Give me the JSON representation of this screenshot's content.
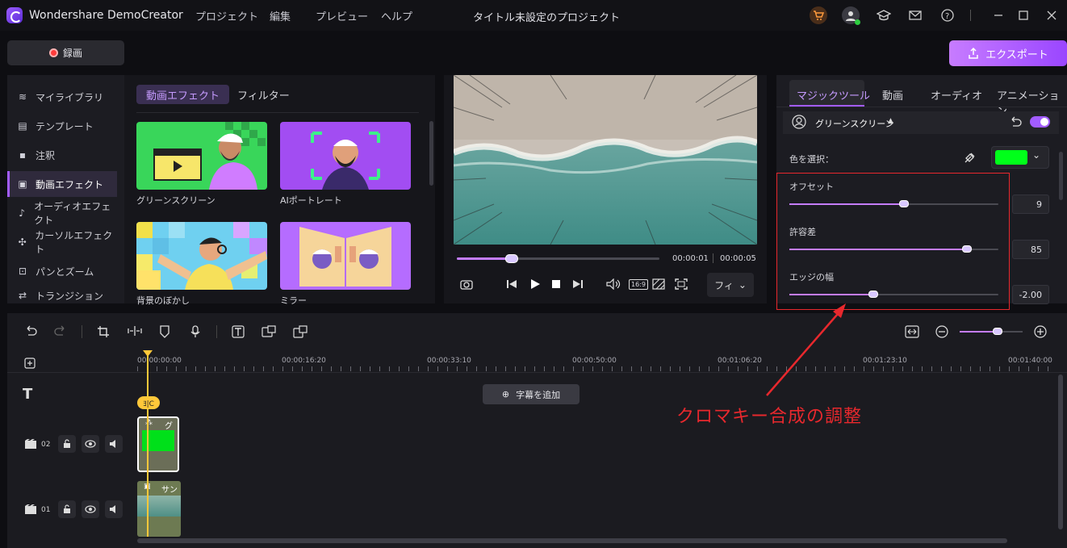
{
  "app": {
    "title": "Wondershare DemoCreator",
    "menu": [
      "プロジェクト",
      "編集",
      "プレビュー",
      "ヘルプ"
    ],
    "project_title": "タイトル未設定のプロジェクト"
  },
  "toolbar": {
    "record_label": "録画",
    "export_label": "エクスポート"
  },
  "sidebar": {
    "items": [
      {
        "label": "マイライブラリ",
        "icon": "layers-icon"
      },
      {
        "label": "テンプレート",
        "icon": "template-icon"
      },
      {
        "label": "注釈",
        "icon": "annotation-icon"
      },
      {
        "label": "動画エフェクト",
        "icon": "video-effect-icon"
      },
      {
        "label": "オーディオエフェクト",
        "icon": "audio-effect-icon"
      },
      {
        "label": "カーソルエフェクト",
        "icon": "cursor-effect-icon"
      },
      {
        "label": "パンとズーム",
        "icon": "pan-zoom-icon"
      },
      {
        "label": "トランジション",
        "icon": "transition-icon"
      }
    ],
    "active_index": 3
  },
  "effects": {
    "tabs": [
      "動画エフェクト",
      "フィルター"
    ],
    "items": [
      "グリーンスクリーン",
      "AIポートレート",
      "背景のぼかし",
      "ミラー"
    ]
  },
  "player": {
    "current_time": "00:00:01",
    "total_time": "00:00:05",
    "fit_label": "フィ",
    "progress": 0.27
  },
  "right": {
    "tabs": [
      "マジックツール",
      "動画",
      "オーディオ",
      "アニメーション"
    ],
    "section_title": "グリーンスクリーン",
    "color_label": "色を選択：",
    "key_color": "#00ff1a",
    "sliders": [
      {
        "label": "オフセット",
        "value": "9",
        "fraction": 0.55
      },
      {
        "label": "許容差",
        "value": "85",
        "fraction": 0.85
      },
      {
        "label": "エッジの幅",
        "value": "-2.00",
        "fraction": 0.4
      }
    ]
  },
  "timeline": {
    "ticks": [
      "00:00:00:00",
      "00:00:16:20",
      "00:00:33:10",
      "00:00:50:00",
      "00:01:06:20",
      "00:01:23:10",
      "00:01:40:00"
    ],
    "add_caption": "字幕を追加",
    "track_numbers": [
      "02",
      "01"
    ],
    "clip_labels": [
      "グ",
      "サン"
    ],
    "marker": "ﾖ|C",
    "zoom": 0.6
  },
  "annotation": "クロマキー合成の調整",
  "colors": {
    "accent": "#a25cff",
    "highlight": "#e8282d"
  }
}
